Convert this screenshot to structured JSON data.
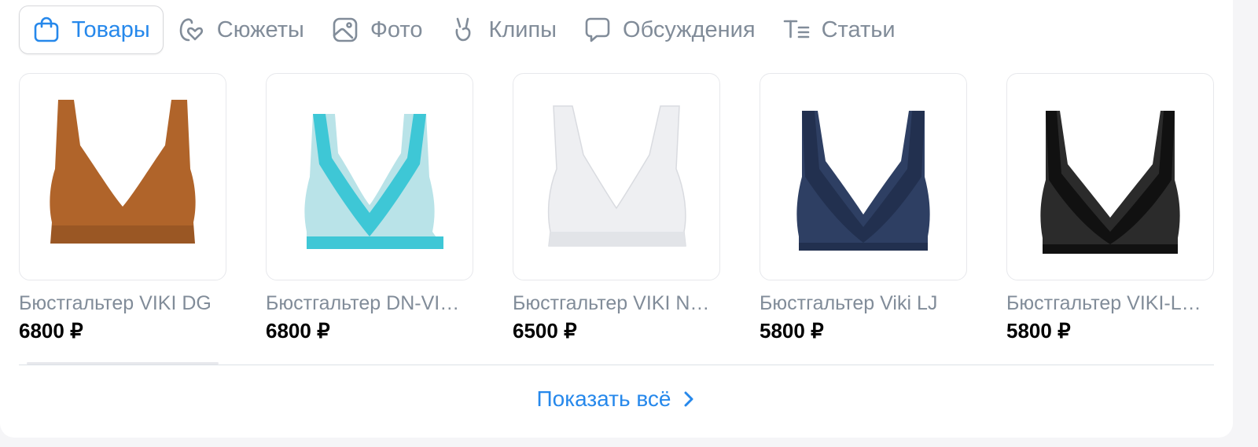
{
  "tabs": [
    {
      "label": "Товары",
      "icon": "shopping-bag-icon",
      "active": true
    },
    {
      "label": "Сюжеты",
      "icon": "story-heart-icon",
      "active": false
    },
    {
      "label": "Фото",
      "icon": "photo-icon",
      "active": false
    },
    {
      "label": "Клипы",
      "icon": "clip-icon",
      "active": false
    },
    {
      "label": "Обсуждения",
      "icon": "discussion-icon",
      "active": false
    },
    {
      "label": "Статьи",
      "icon": "article-icon",
      "active": false
    }
  ],
  "products": [
    {
      "title": "Бюстгальтер VIKI DG",
      "price": "6800 ₽",
      "color": "#b0642a"
    },
    {
      "title": "Бюстгальтер DN-VI…",
      "price": "6800 ₽",
      "color": "#3ec7d6"
    },
    {
      "title": "Бюстгальтер VIKI N…",
      "price": "6500 ₽",
      "color": "#eeeff2"
    },
    {
      "title": "Бюстгальтер Viki LJ",
      "price": "5800 ₽",
      "color": "#22304f"
    },
    {
      "title": "Бюстгальтер VIKI-L…",
      "price": "5800 ₽",
      "color": "#111111"
    }
  ],
  "show_all": {
    "label": "Показать всё",
    "icon": "chevron-right-icon"
  },
  "colors": {
    "accent": "#2688eb",
    "muted": "#818c99",
    "border": "#e7e8ec"
  }
}
